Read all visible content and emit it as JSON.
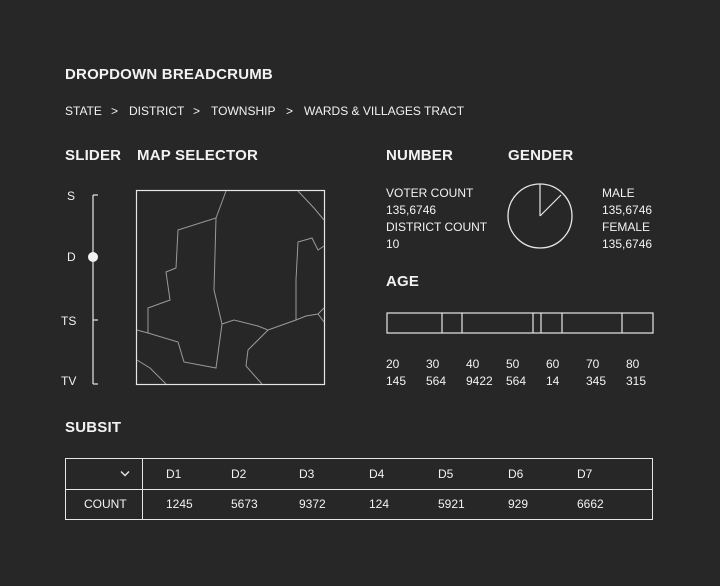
{
  "title": "DROPDOWN BREADCRUMB",
  "breadcrumb": {
    "items": [
      "STATE",
      "DISTRICT",
      "TOWNSHIP",
      "WARDS & VILLAGES TRACT"
    ],
    "separator": ">"
  },
  "slider": {
    "heading": "SLIDER",
    "levels": [
      "S",
      "D",
      "TS",
      "TV"
    ],
    "selected": "D"
  },
  "map": {
    "heading": "MAP SELECTOR"
  },
  "number": {
    "heading": "NUMBER",
    "voter_count_label": "VOTER COUNT",
    "voter_count_value": "135,6746",
    "district_count_label": "DISTRICT COUNT",
    "district_count_value": "10"
  },
  "gender": {
    "heading": "GENDER",
    "male_label": "MALE",
    "male_value": "135,6746",
    "female_label": "FEMALE",
    "female_value": "135,6746"
  },
  "age": {
    "heading": "AGE",
    "groups": [
      "20",
      "30",
      "40",
      "50",
      "60",
      "70",
      "80"
    ],
    "counts": [
      "145",
      "564",
      "9422",
      "564",
      "14",
      "345",
      "315"
    ]
  },
  "subsit": {
    "heading": "SUBSIT",
    "dropdown_icon": "chevron-down-icon",
    "row_label": "COUNT",
    "columns": [
      "D1",
      "D2",
      "D3",
      "D4",
      "D5",
      "D6",
      "D7"
    ],
    "values": [
      "1245",
      "5673",
      "9372",
      "124",
      "5921",
      "929",
      "6662"
    ]
  },
  "colors": {
    "background": "#272727",
    "foreground": "#f2f2f2",
    "lines": "#e6e6e6",
    "map_lines": "#9a9a9a"
  }
}
